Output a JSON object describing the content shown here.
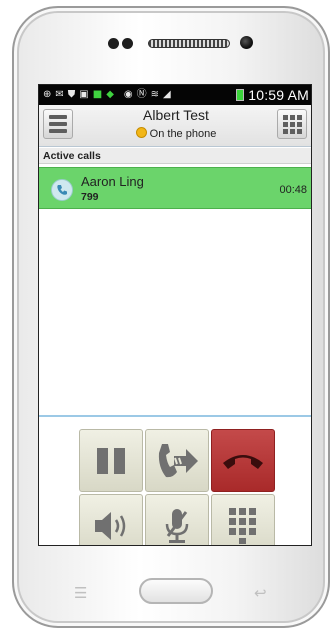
{
  "status_bar": {
    "time": "10:59 AM",
    "icons": [
      "add-icon",
      "email-icon",
      "shield-icon",
      "image-icon",
      "app-icon",
      "app-icon",
      "eye-icon",
      "nfc-icon",
      "wifi-icon",
      "signal-icon"
    ]
  },
  "header": {
    "contact_name": "Albert Test",
    "presence_status": "On the phone"
  },
  "section": {
    "active_calls_label": "Active calls"
  },
  "active_calls": [
    {
      "name": "Aaron Ling",
      "number": "799",
      "duration": "00:48"
    }
  ],
  "controls": [
    {
      "name": "hold-button",
      "icon": "pause-icon"
    },
    {
      "name": "transfer-button",
      "icon": "transfer-icon"
    },
    {
      "name": "hangup-button",
      "icon": "hangup-icon"
    },
    {
      "name": "speaker-button",
      "icon": "speaker-icon"
    },
    {
      "name": "mute-button",
      "icon": "mic-mute-icon"
    },
    {
      "name": "dialpad-button",
      "icon": "dialpad-icon"
    }
  ],
  "colors": {
    "call_row": "#6bd46b",
    "hangup": "#b33434",
    "control_bg": "#e2e2d2",
    "status_bar": "#050505"
  }
}
